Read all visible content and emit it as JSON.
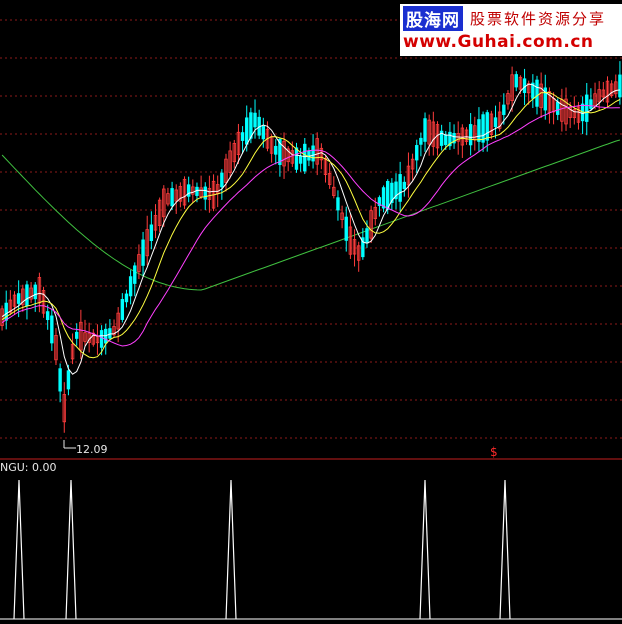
{
  "watermark": {
    "site_name": "股海网",
    "slogan": "股票软件资源分享",
    "url": "www.Guhai.com.cn"
  },
  "price_low_label": "12.09",
  "indicator_label": "NGU: 0.00",
  "signal_marker": "$",
  "colors": {
    "background": "#000000",
    "grid": "#8b1a1a",
    "divider": "#c41e1e",
    "candle_up": "#ff3c3c",
    "candle_down": "#00ffff",
    "ma_short": "#ffffff",
    "ma_mid": "#ffff40",
    "ma_long": "#ff40ff",
    "ma_slow": "#40c040",
    "indicator_line": "#ffffff"
  },
  "chart_data": [
    {
      "type": "candlestick",
      "title": "",
      "xlabel": "",
      "ylabel": "",
      "grid": true,
      "annotations": [
        "12.09"
      ],
      "series": [
        {
          "kind": "candles",
          "count": 150
        },
        {
          "kind": "moving_average",
          "color": "white"
        },
        {
          "kind": "moving_average",
          "color": "yellow"
        },
        {
          "kind": "moving_average",
          "color": "magenta"
        },
        {
          "kind": "moving_average",
          "color": "green"
        }
      ],
      "min_marker_value": 12.09
    },
    {
      "type": "line",
      "title": "NGU: 0.00",
      "series": [
        {
          "name": "NGU",
          "signal_positions": [
            19,
            71,
            231,
            425,
            505
          ]
        }
      ],
      "signal_value": 1,
      "baseline_value": 0
    }
  ]
}
